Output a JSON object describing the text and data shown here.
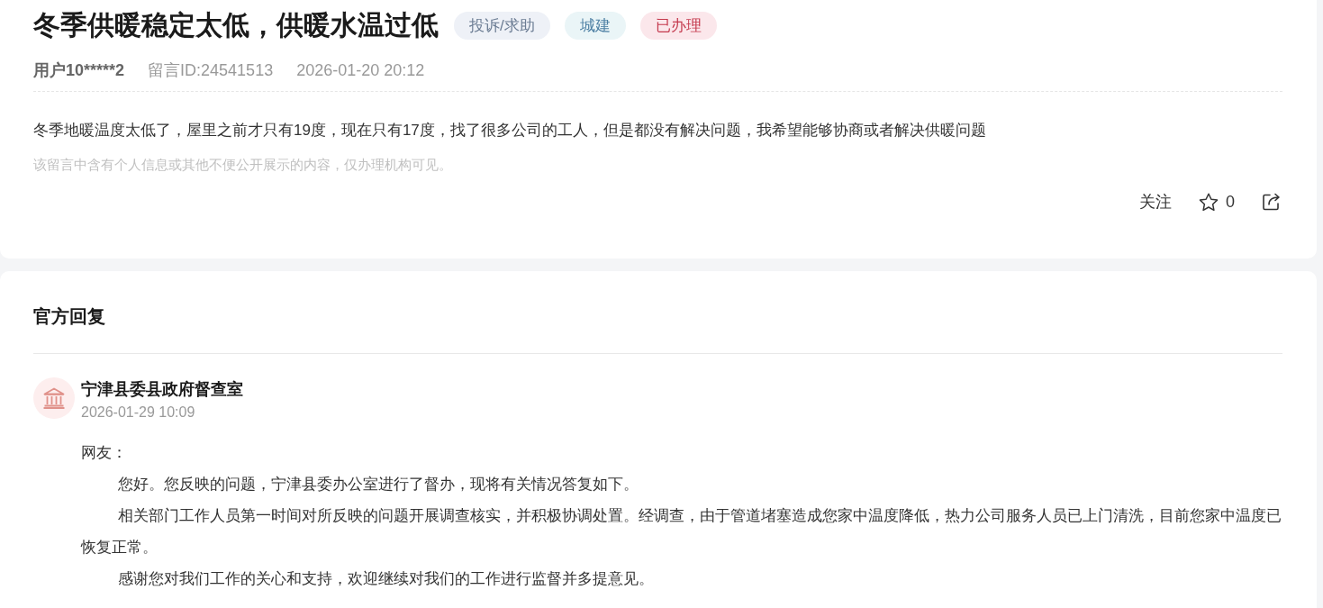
{
  "post": {
    "title": "冬季供暖稳定太低，供暖水温过低",
    "tags": [
      {
        "label": "投诉/求助",
        "kind": "type"
      },
      {
        "label": "城建",
        "kind": "category"
      },
      {
        "label": "已办理",
        "kind": "status"
      }
    ],
    "author": "用户10*****2",
    "message_id": "留言ID:24541513",
    "time": "2026-01-20 20:12",
    "content": "冬季地暖温度太低了，屋里之前才只有19度，现在只有17度，找了很多公司的工人，但是都没有解决问题，我希望能够协商或者解决供暖问题",
    "privacy_note": "该留言中含有个人信息或其他不便公开展示的内容，仅办理机构可见。",
    "actions": {
      "follow": "关注",
      "starred": false,
      "favorite_count": "0"
    }
  },
  "reply": {
    "heading": "官方回复",
    "responder": {
      "name": "宁津县委县政府督查室",
      "time": "2026-01-29 10:09"
    },
    "paragraphs": [
      {
        "text": "网友：",
        "indented": false
      },
      {
        "text": "您好。您反映的问题，宁津县委办公室进行了督办，现将有关情况答复如下。",
        "indented": true
      },
      {
        "text": "相关部门工作人员第一时间对所反映的问题开展调查核实，并积极协调处置。经调查，由于管道堵塞造成您家中温度降低，热力公司服务人员已上门清洗，目前您家中温度已恢复正常。",
        "indented": true
      },
      {
        "text": "感谢您对我们工作的关心和支持，欢迎继续对我们的工作进行监督并多提意见。",
        "indented": true
      }
    ]
  }
}
